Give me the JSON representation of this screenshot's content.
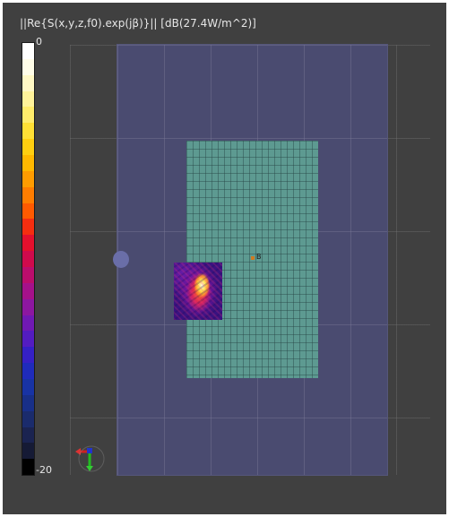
{
  "viewer": {
    "title": "||Re{S(x,y,z,f0).exp(jβ)}|| [dB(27.4W/m^2)]"
  },
  "colorbar": {
    "max_label": "0",
    "min_label": "-20",
    "colors": [
      "#ffffff",
      "#fffde8",
      "#fff8c4",
      "#fff39a",
      "#ffec6b",
      "#ffe035",
      "#ffcf10",
      "#ffb800",
      "#ff9c00",
      "#ff7d00",
      "#ff5a00",
      "#f52e10",
      "#e4102d",
      "#d00a4c",
      "#bb0d6c",
      "#a5118a",
      "#8c17a0",
      "#7019b3",
      "#531cc0",
      "#3520c4",
      "#1f2bbb",
      "#1833a4",
      "#182f88",
      "#1a2b6c",
      "#1a2350",
      "#151a35",
      "#000000"
    ]
  },
  "scene": {
    "probe_label": "B",
    "icons": [
      "axes-orientation-icon"
    ]
  }
}
